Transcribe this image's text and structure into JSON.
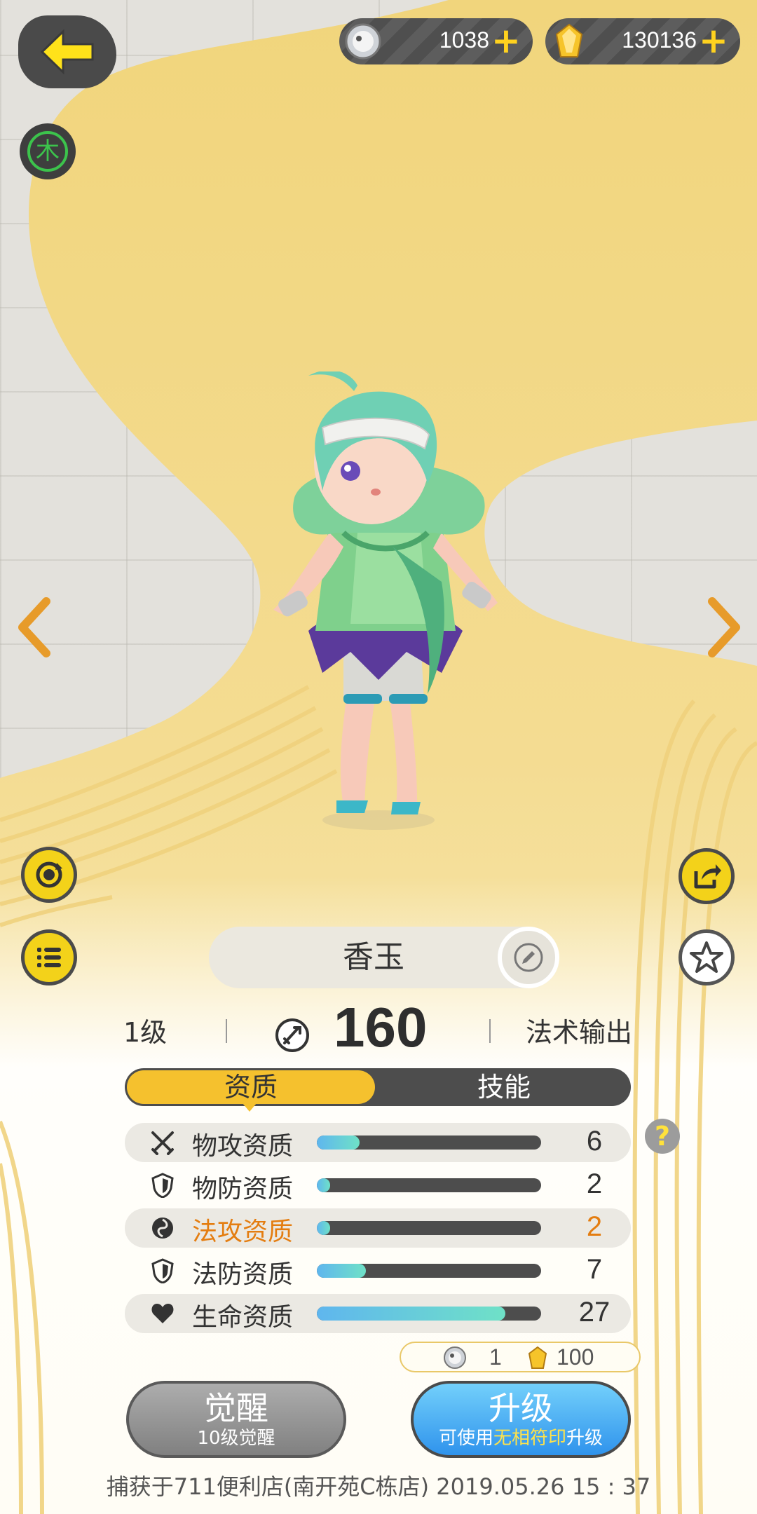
{
  "currencies": [
    {
      "icon": "silver-orb-icon",
      "value": "1038"
    },
    {
      "icon": "gold-crystal-icon",
      "value": "130136"
    }
  ],
  "element": {
    "label": "木",
    "color": "#3cc34c"
  },
  "pet": {
    "name": "香玉",
    "level": "1级",
    "power": "160",
    "role": "法术输出"
  },
  "tabs": {
    "aptitude": "资质",
    "skills": "技能",
    "active": "资质"
  },
  "stats": [
    {
      "icon": "crossed-swords-icon",
      "label": "物攻资质",
      "value": "6",
      "fill": 0.19,
      "shaded": true,
      "highlight": false
    },
    {
      "icon": "shield-icon",
      "label": "物防资质",
      "value": "2",
      "fill": 0.06,
      "shaded": false,
      "highlight": false
    },
    {
      "icon": "magic-orb-icon",
      "label": "法攻资质",
      "value": "2",
      "fill": 0.06,
      "shaded": true,
      "highlight": true
    },
    {
      "icon": "shield-icon",
      "label": "法防资质",
      "value": "7",
      "fill": 0.22,
      "shaded": false,
      "highlight": false
    },
    {
      "icon": "heart-icon",
      "label": "生命资质",
      "value": "27",
      "fill": 0.84,
      "shaded": true,
      "highlight": false
    }
  ],
  "cost": {
    "orb_count": "1",
    "crystal_count": "100"
  },
  "awaken_button": {
    "title": "觉醒",
    "subtitle": "10级觉醒"
  },
  "upgrade_button": {
    "title": "升级",
    "sub_prefix": "可使用",
    "sub_highlight": "无相符印",
    "sub_suffix": "升级"
  },
  "footer": "捕获于711便利店(南开苑C栋店)  2019.05.26   15 : 37",
  "colors": {
    "accent_yellow": "#f5c12e",
    "highlight_orange": "#e47d10",
    "bar_fill": "#5fb6ee",
    "upgrade_blue": "#2f93ec"
  }
}
